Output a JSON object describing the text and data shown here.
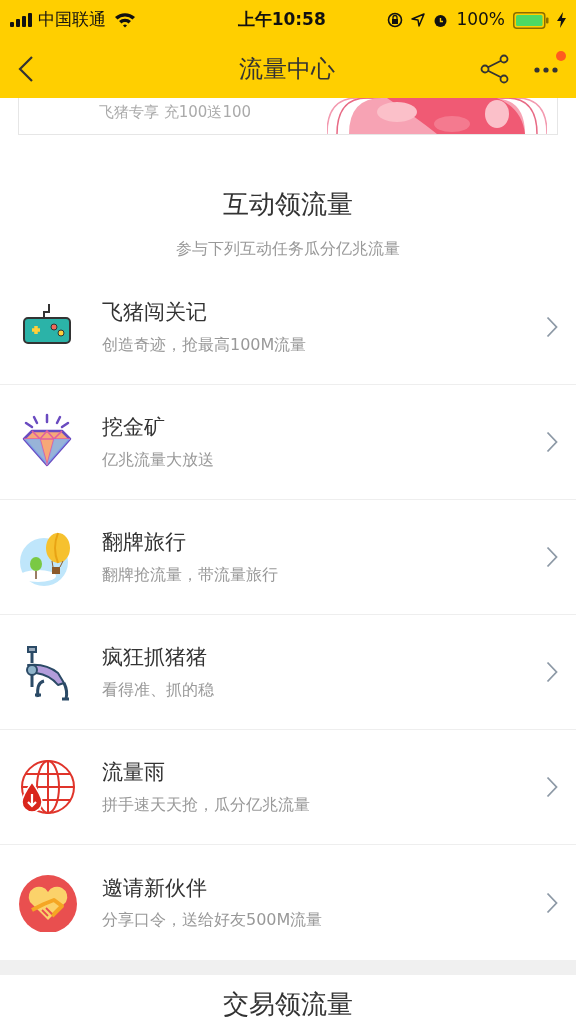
{
  "status_bar": {
    "carrier": "中国联通",
    "time": "上午10:58",
    "battery": "100%"
  },
  "header": {
    "title": "流量中心",
    "more_notification": true
  },
  "banner": {
    "text": "飞猪专享 充100送100"
  },
  "section": {
    "title": "互动领流量",
    "subtitle": "参与下列互动任务瓜分亿兆流量"
  },
  "items": [
    {
      "kind": "gamepad",
      "title": "飞猪闯关记",
      "subtitle": "创造奇迹，抢最高100M流量"
    },
    {
      "kind": "diamond",
      "title": "挖金矿",
      "subtitle": "亿兆流量大放送"
    },
    {
      "kind": "balloon",
      "title": "翻牌旅行",
      "subtitle": "翻牌抢流量，带流量旅行"
    },
    {
      "kind": "claw",
      "title": "疯狂抓猪猪",
      "subtitle": "看得准、抓的稳"
    },
    {
      "kind": "globe",
      "title": "流量雨",
      "subtitle": "拼手速天天抢，瓜分亿兆流量"
    },
    {
      "kind": "handshake",
      "title": "邀请新伙伴",
      "subtitle": "分享口令，送给好友500M流量"
    }
  ],
  "next_section": {
    "title": "交易领流量"
  }
}
